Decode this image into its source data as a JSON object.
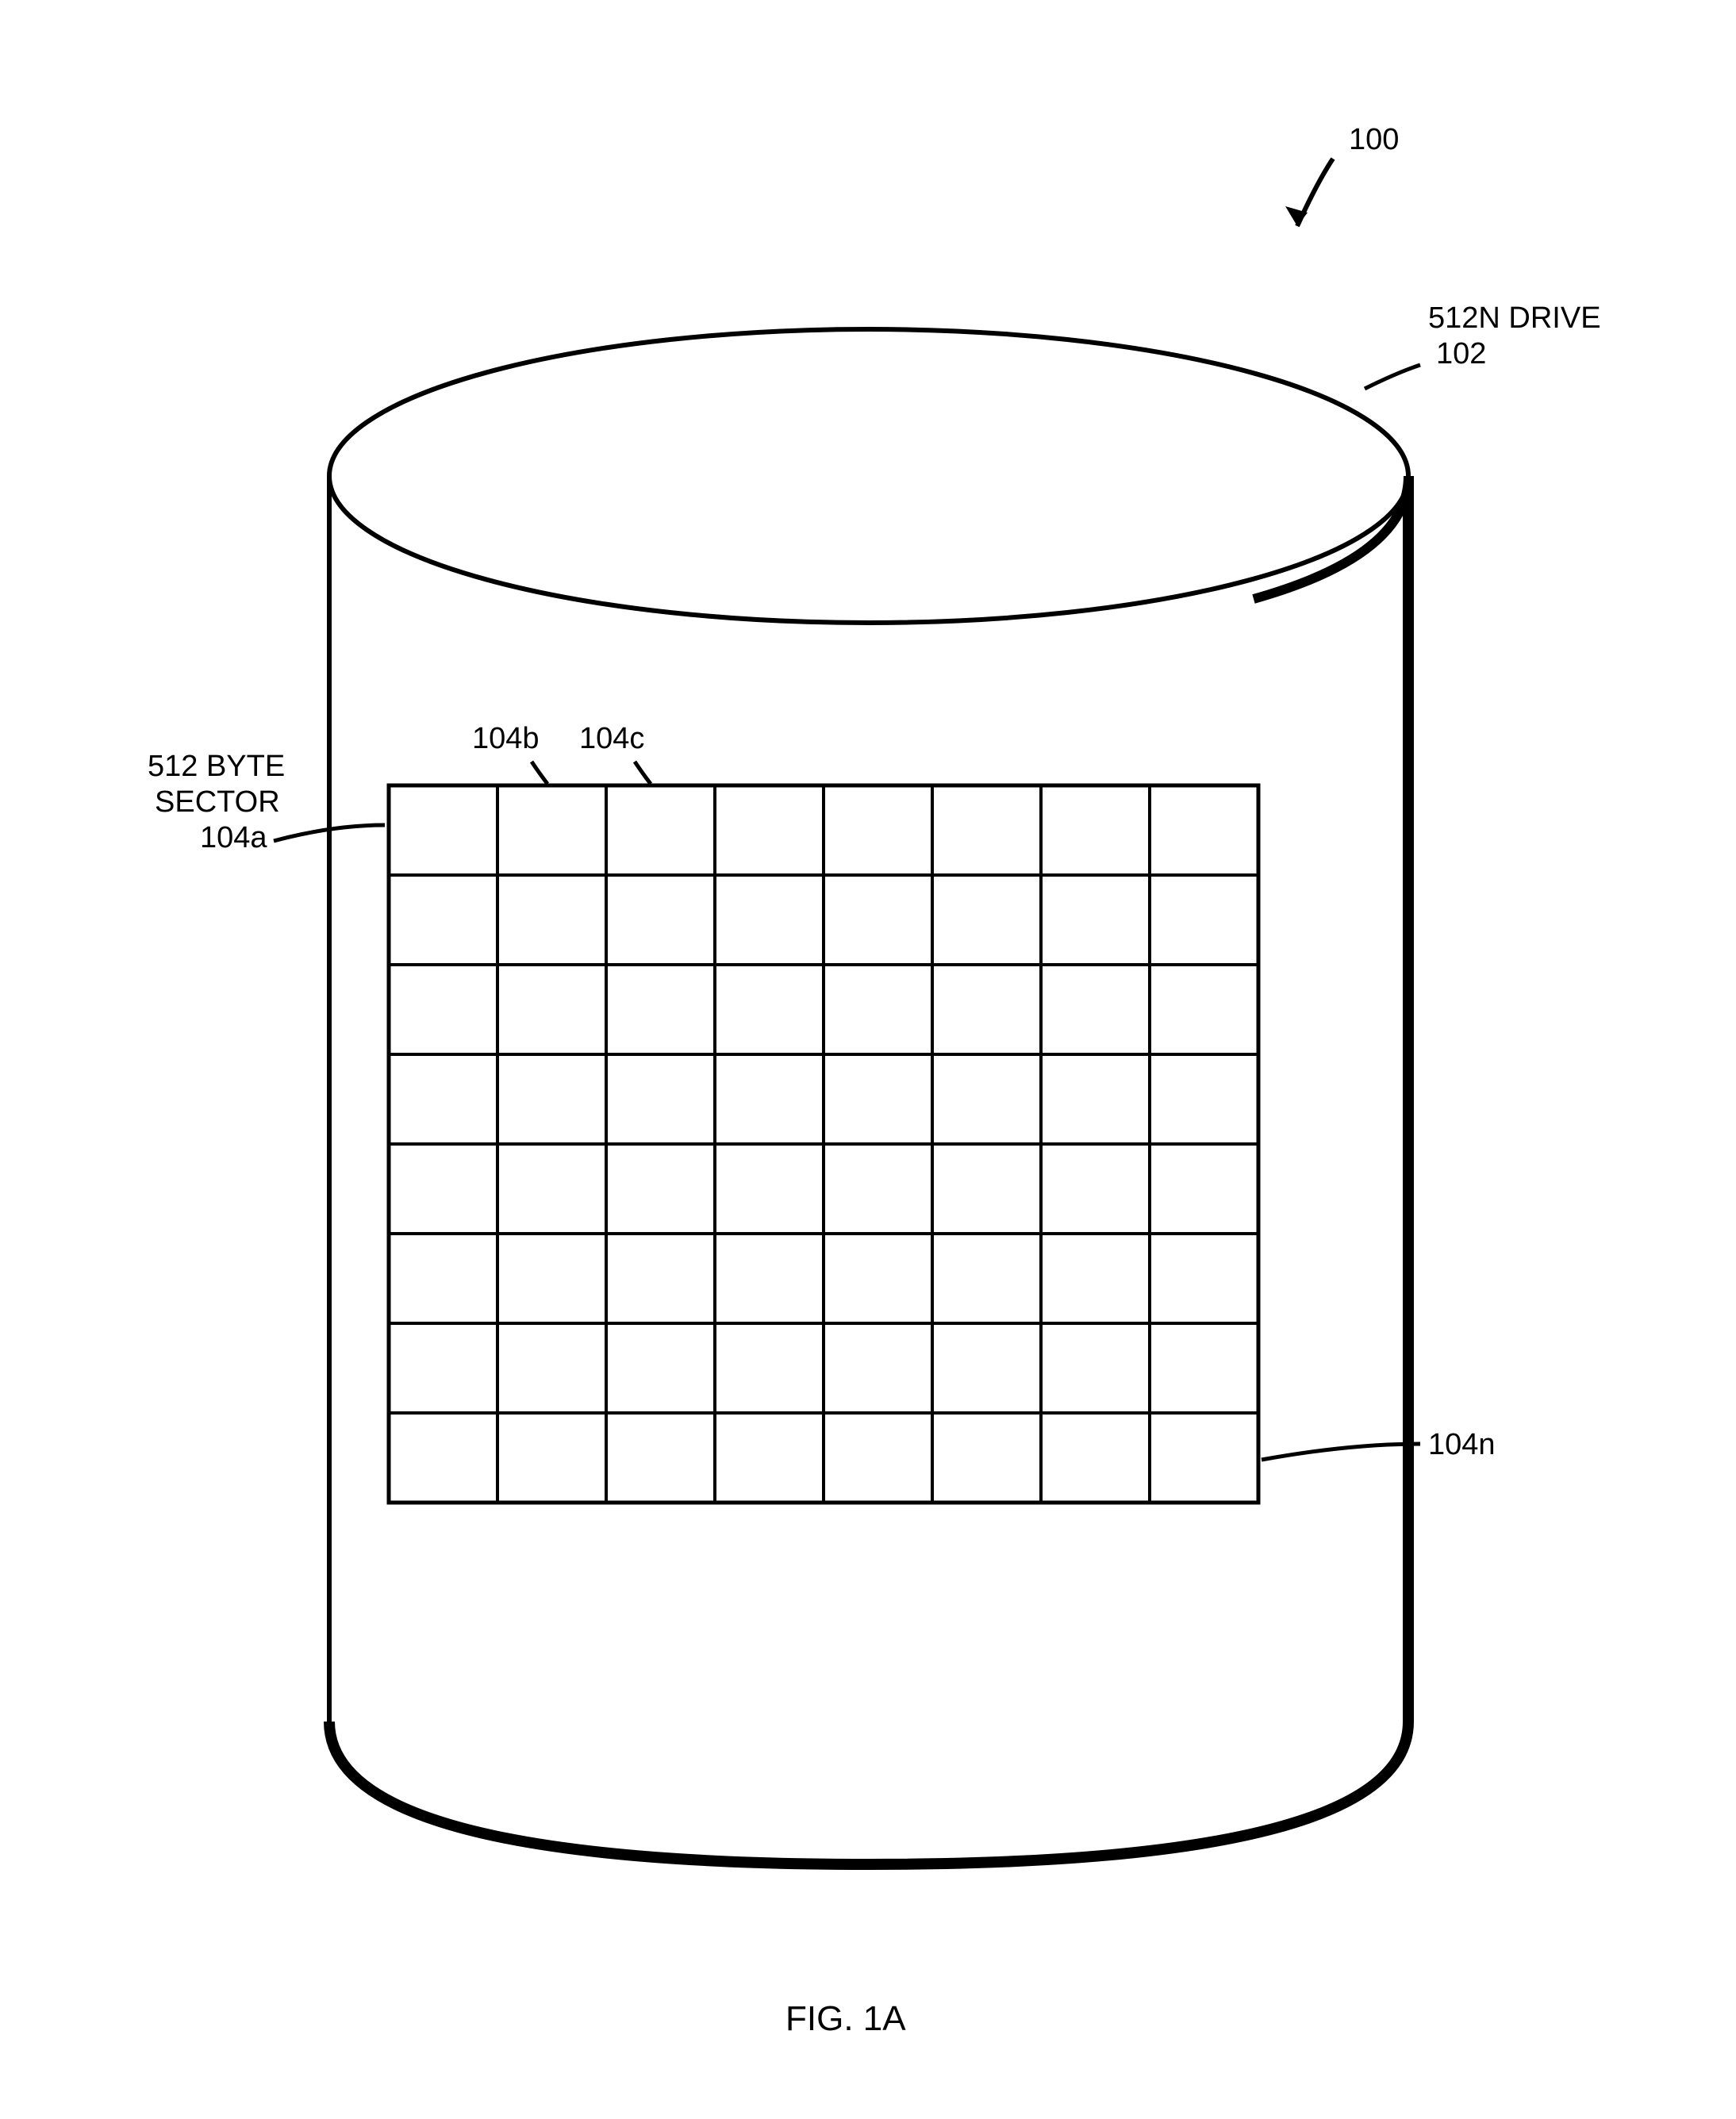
{
  "labels": {
    "reference_100": "100",
    "drive_label": "512N DRIVE",
    "drive_ref": "102",
    "sector_label_line1": "512 BYTE",
    "sector_label_line2": "SECTOR",
    "sector_ref_a": "104a",
    "sector_ref_b": "104b",
    "sector_ref_c": "104c",
    "sector_ref_n": "104n",
    "figure": "FIG. 1A"
  },
  "grid": {
    "rows": 8,
    "cols": 8
  }
}
